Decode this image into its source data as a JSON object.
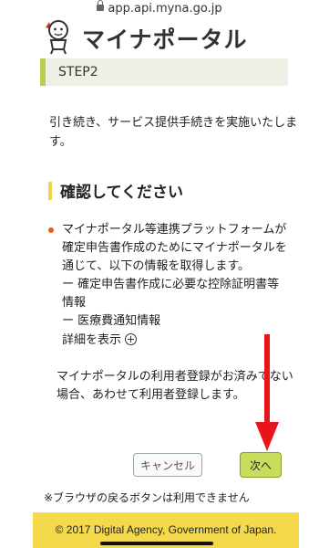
{
  "browser": {
    "url": "app.api.myna.go.jp"
  },
  "header": {
    "brand": "マイナポータル"
  },
  "step": {
    "label": "STEP2"
  },
  "intro": {
    "text": "引き続き、サービス提供手続きを実施いたします。"
  },
  "section": {
    "heading": "確認してください"
  },
  "bullet": {
    "text": "マイナポータル等連携プラットフォームが確定申告書作成のためにマイナポータルを通じて、以下の情報を取得します。",
    "items": [
      "ー 確定申告書作成に必要な控除証明書等情報",
      "ー 医療費通知情報"
    ]
  },
  "details": {
    "label": "詳細を表示"
  },
  "note": {
    "text": "マイナポータルの利用者登録がお済みでない場合、あわせて利用者登録します。"
  },
  "buttons": {
    "cancel": "キャンセル",
    "next": "次へ"
  },
  "back_note": "※ブラウザの戻るボタンは利用できません",
  "footer": {
    "copyright": "© 2017 Digital Agency, Government of Japan."
  },
  "colors": {
    "accent_green": "#b9cd4f",
    "accent_yellow": "#f3d34a",
    "bullet_orange": "#e85a1b",
    "annotation_red": "#e8141b"
  }
}
